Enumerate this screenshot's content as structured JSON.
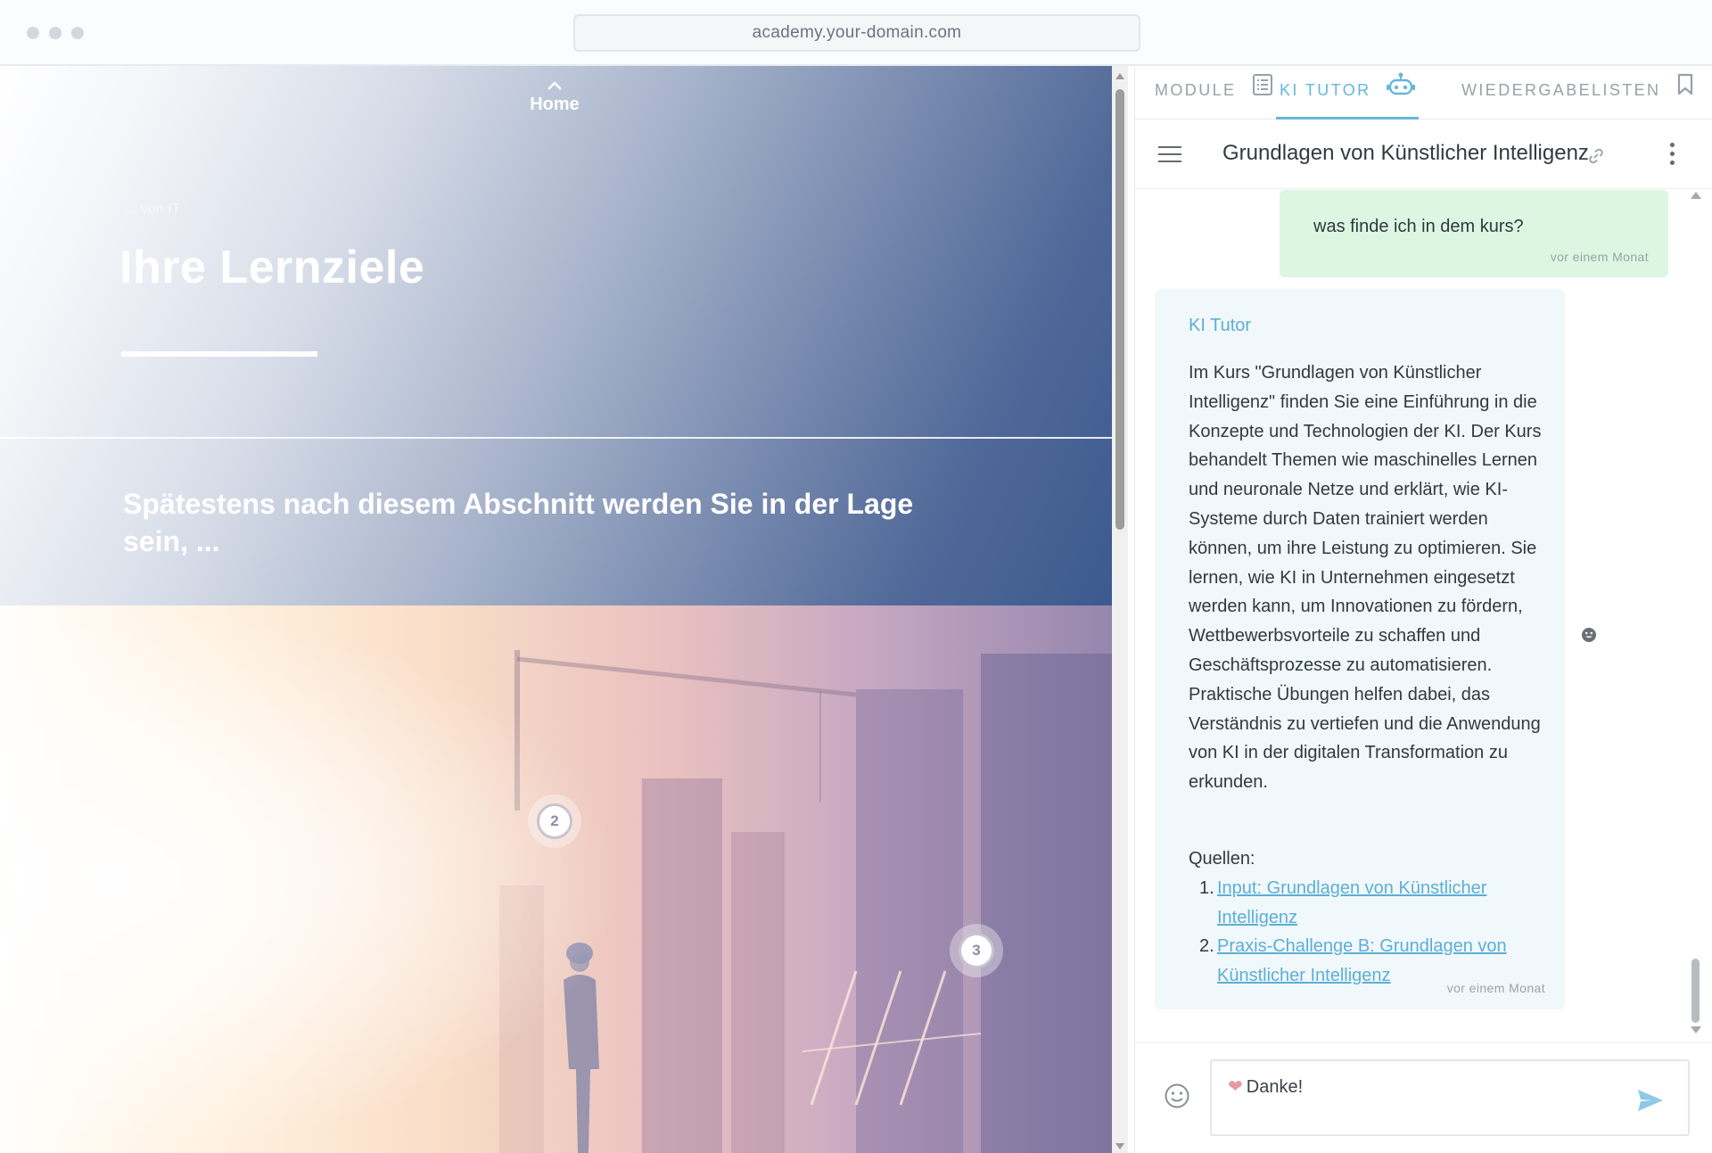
{
  "browser": {
    "url": "academy.your-domain.com"
  },
  "course": {
    "home_label": "Home",
    "breadcrumb": "... von IT",
    "title": "Ihre Lernziele",
    "subtitle": "Spätestens nach diesem Abschnitt werden Sie in der Lage sein, ...",
    "markers": [
      "2",
      "3"
    ]
  },
  "sidebar": {
    "tabs": [
      {
        "label": "MODULE",
        "icon": "list-icon",
        "active": false
      },
      {
        "label": "KI TUTOR",
        "icon": "robot-icon",
        "active": true
      },
      {
        "label": "WIEDERGABELISTEN",
        "icon": "bookmark-icon",
        "active": false
      }
    ],
    "chat_title": "Grundlagen von Künstlicher Intelligenz",
    "messages": {
      "user": {
        "text": "was finde ich in dem kurs?",
        "time": "vor einem Monat"
      },
      "bot": {
        "name": "KI Tutor",
        "text": "Im Kurs \"Grundlagen von Künstlicher Intelligenz\" finden Sie eine Einführung in die Konzepte und Technologien der KI. Der Kurs behandelt Themen wie maschinelles Lernen und neuronale Netze und erklärt, wie KI-Systeme durch Daten trainiert werden können, um ihre Leistung zu optimieren. Sie lernen, wie KI in Unternehmen eingesetzt werden kann, um Innovationen zu fördern, Wettbewerbsvorteile zu schaffen und Geschäftsprozesse zu automatisieren. Praktische Übungen helfen dabei, das Verständnis zu vertiefen und die Anwendung von KI in der digitalen Transformation zu erkunden.",
        "sources_label": "Quellen:",
        "sources": [
          {
            "num": "1.",
            "label": "Input: Grundlagen von Künstlicher Intelligenz"
          },
          {
            "num": "2.",
            "label": "Praxis-Challenge B: Grundlagen von Künstlicher Intelligenz"
          }
        ],
        "time": "vor einem Monat"
      }
    },
    "composer": {
      "value": "Danke!"
    }
  },
  "colors": {
    "accent": "#64b7dd",
    "user_bubble": "#dcf6e2",
    "bot_bubble": "#f1f8fc",
    "hero_dark": "#3c5a8f"
  }
}
